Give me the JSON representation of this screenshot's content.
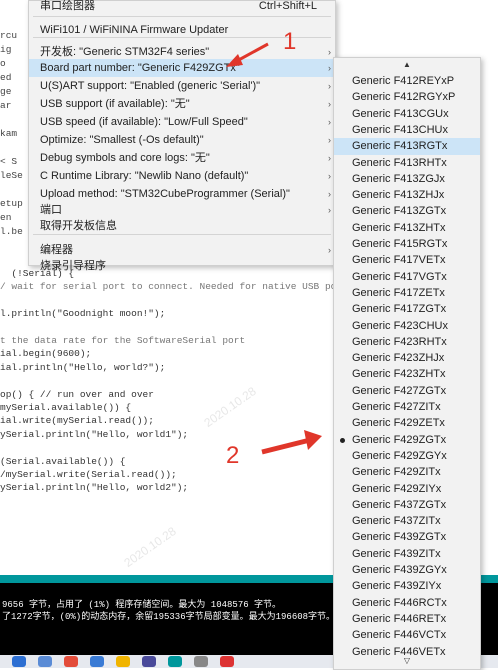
{
  "editor": {
    "left_fragments": [
      "rcu",
      "ig",
      "o",
      "ed",
      "ge",
      "ar",
      "",
      "kam",
      "",
      "< S",
      "leSe",
      "",
      "etup",
      "en",
      "l.be"
    ],
    "code_lines": [
      "  (!Serial) {",
      "/ wait for serial port to connect. Needed for native USB port o",
      "",
      "l.println(\"Goodnight moon!\");",
      "",
      "t the data rate for the SoftwareSerial port",
      "ial.begin(9600);",
      "ial.println(\"Hello, world?\");",
      "",
      "op() { // run over and over",
      "mySerial.available()) {",
      "ial.write(mySerial.read());",
      "ySerial.println(\"Hello, world1\");",
      "",
      "(Serial.available()) {",
      "/mySerial.write(Serial.read());",
      "ySerial.println(\"Hello, world2\");"
    ]
  },
  "console": {
    "lines": [
      "9656 字节，占用了 (1%) 程序存储空间。最大为 1048576 字节。",
      "了1272字节，(0%)的动态内存，余留195336字节局部变量。最大为196608字节。"
    ]
  },
  "tools_menu": {
    "items": [
      {
        "label": "串口绘图器",
        "shortcut": "Ctrl+Shift+L",
        "arrow": ""
      },
      {
        "label": "WiFi101 / WiFiNINA Firmware Updater",
        "shortcut": "",
        "arrow": ""
      },
      {
        "label": "开发板: \"Generic STM32F4 series\"",
        "shortcut": "",
        "arrow": "›"
      },
      {
        "label": "Board part number: \"Generic F429ZGTx\"",
        "shortcut": "",
        "arrow": "›"
      },
      {
        "label": "U(S)ART support: \"Enabled (generic 'Serial')\"",
        "shortcut": "",
        "arrow": "›"
      },
      {
        "label": "USB support (if available): \"无\"",
        "shortcut": "",
        "arrow": "›"
      },
      {
        "label": "USB speed (if available): \"Low/Full Speed\"",
        "shortcut": "",
        "arrow": "›"
      },
      {
        "label": "Optimize: \"Smallest (-Os default)\"",
        "shortcut": "",
        "arrow": "›"
      },
      {
        "label": "Debug symbols and core logs: \"无\"",
        "shortcut": "",
        "arrow": "›"
      },
      {
        "label": "C Runtime Library: \"Newlib Nano (default)\"",
        "shortcut": "",
        "arrow": "›"
      },
      {
        "label": "Upload method: \"STM32CubeProgrammer (Serial)\"",
        "shortcut": "",
        "arrow": "›"
      },
      {
        "label": "端口",
        "shortcut": "",
        "arrow": "›"
      },
      {
        "label": "取得开发板信息",
        "shortcut": "",
        "arrow": ""
      },
      {
        "label": "编程器",
        "shortcut": "",
        "arrow": "›"
      },
      {
        "label": "烧录引导程序",
        "shortcut": "",
        "arrow": ""
      }
    ],
    "highlighted_index": 3
  },
  "submenu": {
    "scroll_up": "▲",
    "scroll_down": "▽",
    "items": [
      "Generic F412REYxP",
      "Generic F412RGYxP",
      "Generic F413CGUx",
      "Generic F413CHUx",
      "Generic F413RGTx",
      "Generic F413RHTx",
      "Generic F413ZGJx",
      "Generic F413ZHJx",
      "Generic F413ZGTx",
      "Generic F413ZHTx",
      "Generic F415RGTx",
      "Generic F417VETx",
      "Generic F417VGTx",
      "Generic F417ZETx",
      "Generic F417ZGTx",
      "Generic F423CHUx",
      "Generic F423RHTx",
      "Generic F423ZHJx",
      "Generic F423ZHTx",
      "Generic F427ZGTx",
      "Generic F427ZITx",
      "Generic F429ZETx",
      "Generic F429ZGTx",
      "Generic F429ZGYx",
      "Generic F429ZITx",
      "Generic F429ZIYx",
      "Generic F437ZGTx",
      "Generic F437ZITx",
      "Generic F439ZGTx",
      "Generic F439ZITx",
      "Generic F439ZGYx",
      "Generic F439ZIYx",
      "Generic F446RCTx",
      "Generic F446RETx",
      "Generic F446VCTx",
      "Generic F446VETx"
    ],
    "hovered_index": 4,
    "selected_index": 22
  },
  "annotations": {
    "marker_1": "1",
    "marker_2": "2",
    "color": "#e0362a"
  },
  "colors": {
    "menu_highlight": "#cce4f7",
    "console_bg": "#000000",
    "arduino_teal": "#00979c"
  }
}
